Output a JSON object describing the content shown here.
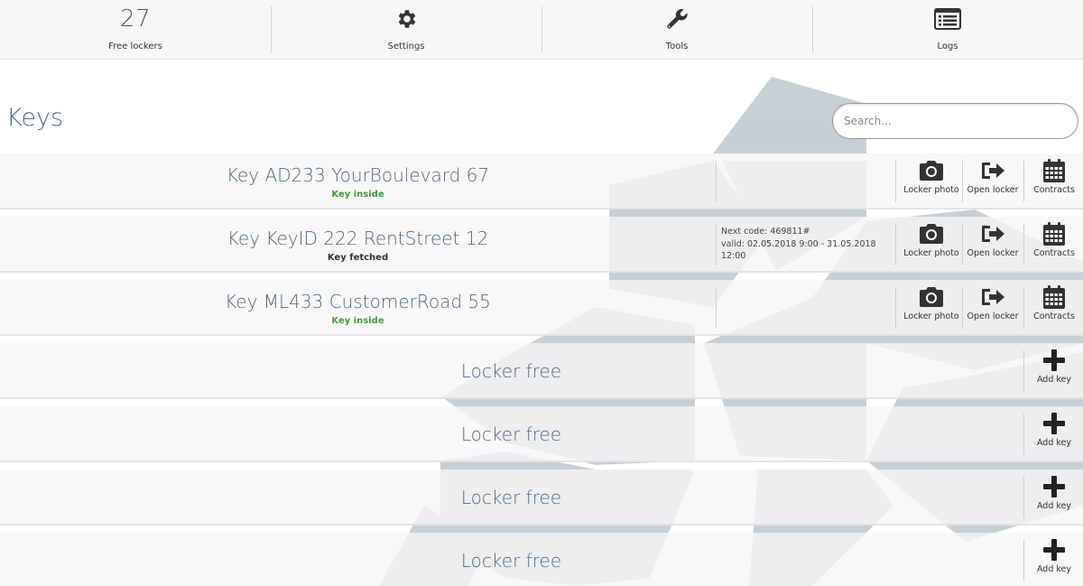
{
  "nav": {
    "items": [
      {
        "count": "27",
        "label": "Free lockers",
        "icon": null
      },
      {
        "count": null,
        "label": "Settings",
        "icon": "gear-icon"
      },
      {
        "count": null,
        "label": "Tools",
        "icon": "wrench-icon"
      },
      {
        "count": null,
        "label": "Logs",
        "icon": "list-icon"
      }
    ]
  },
  "page": {
    "title": "Keys",
    "search_placeholder": "Search..."
  },
  "keys": [
    {
      "title": "Key AD233 YourBoulevard 67",
      "status": "Key inside",
      "status_type": "inside",
      "code_line1": "",
      "code_line2": ""
    },
    {
      "title": "Key KeyID 222 RentStreet 12",
      "status": "Key fetched",
      "status_type": "fetched",
      "code_line1": "Next code: 469811#",
      "code_line2": "valid: 02.05.2018 9:00 - 31.05.2018 12:00"
    },
    {
      "title": "Key ML433 CustomerRoad 55",
      "status": "Key inside",
      "status_type": "inside",
      "code_line1": "",
      "code_line2": ""
    }
  ],
  "actions": {
    "locker_photo": "Locker photo",
    "open_locker": "Open locker",
    "contracts": "Contracts",
    "add_key": "Add key"
  },
  "free_lockers": [
    {
      "label": "Locker free"
    },
    {
      "label": "Locker free"
    },
    {
      "label": "Locker free"
    },
    {
      "label": "Locker free"
    }
  ],
  "colors": {
    "accent_text": "#506a86",
    "status_inside": "#3f9a3f",
    "status_fetched": "#333333",
    "pattern": "#c3cdd3"
  }
}
